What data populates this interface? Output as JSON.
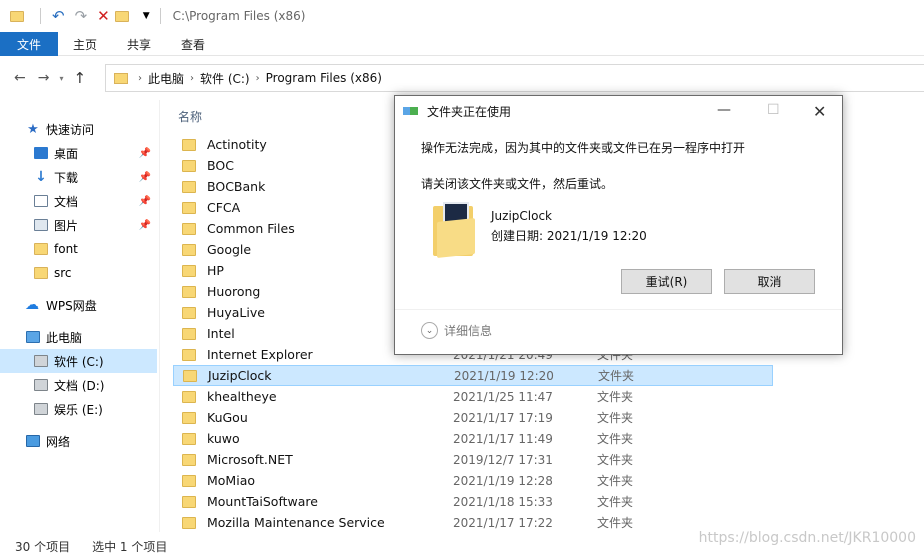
{
  "window": {
    "title_path": "C:\\Program Files (x86)"
  },
  "ribbon": {
    "tabs": [
      "文件",
      "主页",
      "共享",
      "查看"
    ]
  },
  "address": {
    "crumbs": [
      "此电脑",
      "软件 (C:)",
      "Program Files (x86)"
    ]
  },
  "sidebar": {
    "quick_access": "快速访问",
    "items": [
      {
        "label": "桌面",
        "icon": "desktop-icon",
        "pinned": true
      },
      {
        "label": "下载",
        "icon": "download-icon",
        "pinned": true
      },
      {
        "label": "文档",
        "icon": "document-icon",
        "pinned": true
      },
      {
        "label": "图片",
        "icon": "picture-icon",
        "pinned": true
      },
      {
        "label": "font",
        "icon": "folder-icon",
        "pinned": false
      },
      {
        "label": "src",
        "icon": "folder-icon",
        "pinned": false
      }
    ],
    "wps": "WPS网盘",
    "this_pc": "此电脑",
    "drives": [
      "软件 (C:)",
      "文档 (D:)",
      "娱乐 (E:)"
    ],
    "network": "网络"
  },
  "filelist": {
    "header_name": "名称",
    "rows": [
      {
        "name": "Actinotity",
        "date": "",
        "type": ""
      },
      {
        "name": "BOC",
        "date": "",
        "type": ""
      },
      {
        "name": "BOCBank",
        "date": "",
        "type": ""
      },
      {
        "name": "CFCA",
        "date": "",
        "type": ""
      },
      {
        "name": "Common Files",
        "date": "",
        "type": ""
      },
      {
        "name": "Google",
        "date": "",
        "type": ""
      },
      {
        "name": "HP",
        "date": "",
        "type": ""
      },
      {
        "name": "Huorong",
        "date": "",
        "type": ""
      },
      {
        "name": "HuyaLive",
        "date": "",
        "type": ""
      },
      {
        "name": "Intel",
        "date": "",
        "type": ""
      },
      {
        "name": "Internet Explorer",
        "date": "2021/1/21 20:49",
        "type": "文件夹"
      },
      {
        "name": "JuzipClock",
        "date": "2021/1/19 12:20",
        "type": "文件夹"
      },
      {
        "name": "khealtheye",
        "date": "2021/1/25 11:47",
        "type": "文件夹"
      },
      {
        "name": "KuGou",
        "date": "2021/1/17 17:19",
        "type": "文件夹"
      },
      {
        "name": "kuwo",
        "date": "2021/1/17 11:49",
        "type": "文件夹"
      },
      {
        "name": "Microsoft.NET",
        "date": "2019/12/7 17:31",
        "type": "文件夹"
      },
      {
        "name": "MoMiao",
        "date": "2021/1/19 12:28",
        "type": "文件夹"
      },
      {
        "name": "MountTaiSoftware",
        "date": "2021/1/18 15:33",
        "type": "文件夹"
      },
      {
        "name": "Mozilla Maintenance Service",
        "date": "2021/1/17 17:22",
        "type": "文件夹"
      }
    ]
  },
  "status": {
    "count": "30 个项目",
    "selected": "选中 1 个项目",
    "watermark": "https://blog.csdn.net/JKR10000"
  },
  "dialog": {
    "title": "文件夹正在使用",
    "message1": "操作无法完成，因为其中的文件夹或文件已在另一程序中打开",
    "message2": "请关闭该文件夹或文件，然后重试。",
    "file_name": "JuzipClock",
    "created": "创建日期: 2021/1/19 12:20",
    "retry": "重试(R)",
    "cancel": "取消",
    "details": "详细信息"
  }
}
